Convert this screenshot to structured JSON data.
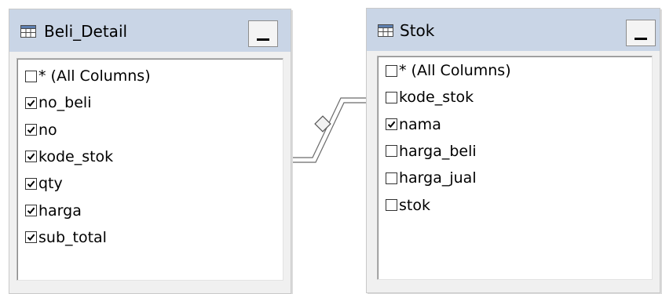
{
  "tables": [
    {
      "title": "Beli_Detail",
      "columns": [
        {
          "label": "* (All Columns)",
          "checked": false
        },
        {
          "label": "no_beli",
          "checked": true
        },
        {
          "label": "no",
          "checked": true
        },
        {
          "label": "kode_stok",
          "checked": true
        },
        {
          "label": "qty",
          "checked": true
        },
        {
          "label": "harga",
          "checked": true
        },
        {
          "label": "sub_total",
          "checked": true
        }
      ]
    },
    {
      "title": "Stok",
      "columns": [
        {
          "label": "* (All Columns)",
          "checked": false
        },
        {
          "label": "kode_stok",
          "checked": false
        },
        {
          "label": "nama",
          "checked": true
        },
        {
          "label": "harga_beli",
          "checked": false
        },
        {
          "label": "harga_jual",
          "checked": false
        },
        {
          "label": "stok",
          "checked": false
        }
      ]
    }
  ],
  "colors": {
    "titlebar": "#c9d5e6",
    "window_bg": "#f0f0f0",
    "relationship_line": "#6b6b6b"
  }
}
